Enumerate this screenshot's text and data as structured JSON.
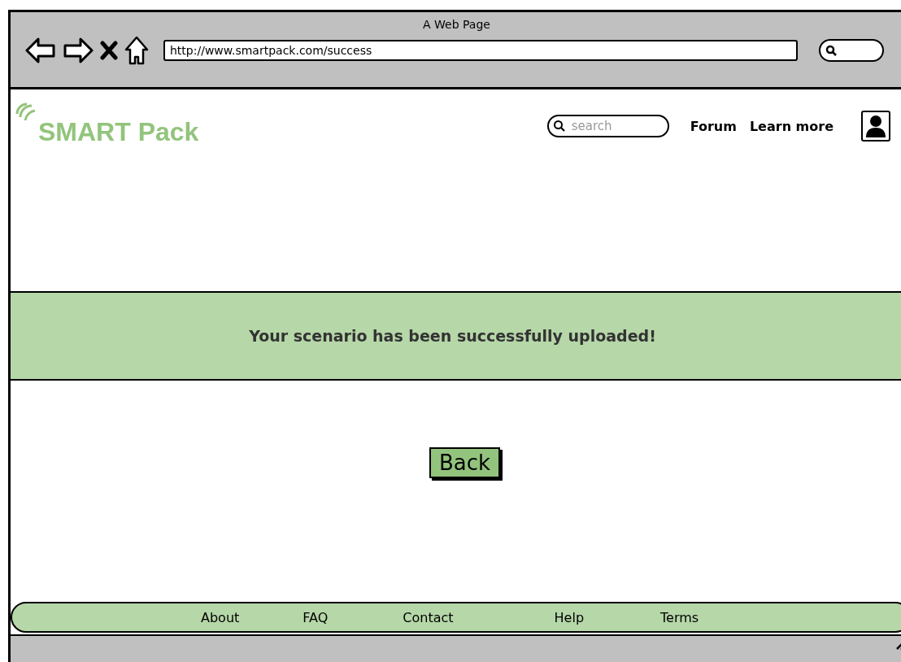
{
  "window": {
    "title": "A Web Page"
  },
  "browser": {
    "url": "http://www.smartpack.com/success"
  },
  "header": {
    "logo": "SMART Pack",
    "search": {
      "placeholder": "search"
    },
    "nav": [
      "Forum",
      "Learn more"
    ]
  },
  "banner": {
    "message": "Your scenario has been successfully uploaded!"
  },
  "button": "Back",
  "footer": [
    "About",
    "FAQ",
    "Contact",
    "Help",
    "Terms"
  ]
}
